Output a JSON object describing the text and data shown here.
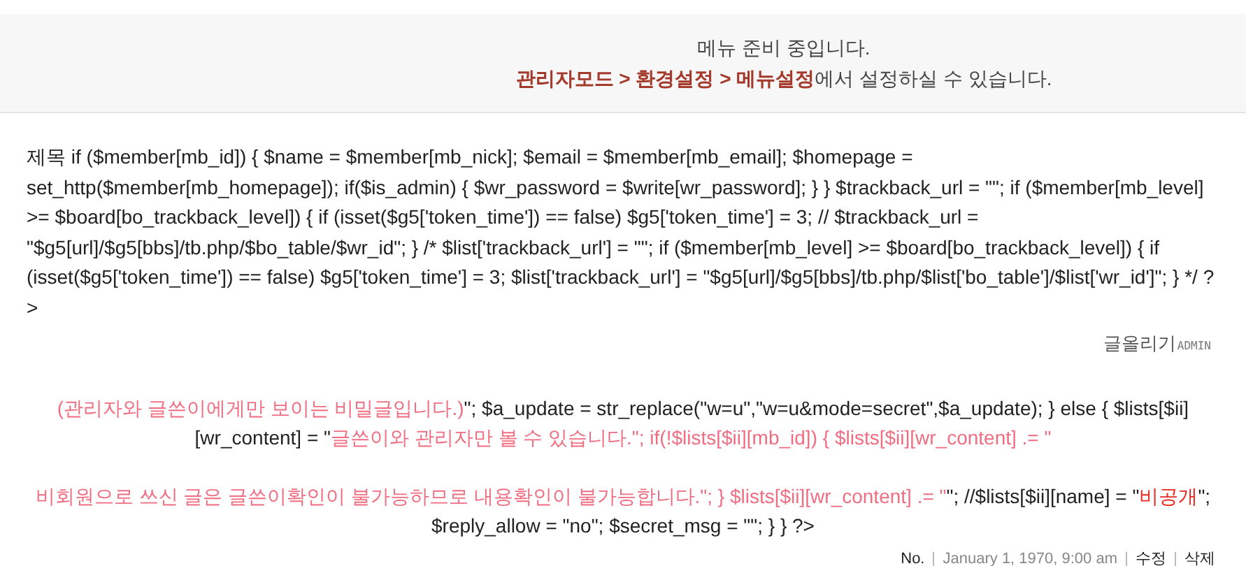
{
  "notice": {
    "message": "메뉴 준비 중입니다.",
    "path": "관리자모드 > 환경설정 > 메뉴설정",
    "suffix": "에서 설정하실 수 있습니다."
  },
  "post": {
    "body": "제목 if ($member[mb_id]) { $name = $member[mb_nick]; $email = $member[mb_email]; $homepage = set_http($member[mb_homepage]); if($is_admin) { $wr_password = $write[wr_password]; } } $trackback_url = \"\"; if ($member[mb_level] >= $board[bo_trackback_level]) { if (isset($g5['token_time']) == false) $g5['token_time'] = 3; // $trackback_url = \"$g5[url]/$g5[bbs]/tb.php/$bo_table/$wr_id\"; } /* $list['trackback_url'] = \"\"; if ($member[mb_level] >= $board[bo_trackback_level]) { if (isset($g5['token_time']) == false) $g5['token_time'] = 3; $list['trackback_url'] = \"$g5[url]/$g5[bbs]/tb.php/$list['bo_table']/$list['wr_id']\"; } */ ?>",
    "author": {
      "name": "글올리기",
      "badge": "ADMIN"
    }
  },
  "comment": {
    "segments": [
      {
        "kind": "pink",
        "text": "(관리자와 글쓴이에게만 보이는 비밀글입니다.)"
      },
      {
        "kind": "plain",
        "text": "\"; $a_update = str_replace(\"w=u\",\"w=u&mode=secret\",$a_update); } else { $lists[$ii][wr_content] = \""
      },
      {
        "kind": "pink",
        "text": "글쓴이와 관리자만 볼 수 있습니다.\"; if(!$lists[$ii][mb_id]) { $lists[$ii][wr_content] .= \""
      },
      {
        "kind": "break"
      },
      {
        "kind": "pink",
        "text": "비회원으로 쓰신 글은 글쓴이확인이 불가능하므로 내용확인이 불가능합니다.\"; } $lists[$ii][wr_content] .= \""
      },
      {
        "kind": "plain",
        "text": "\"; //$lists[$ii][name] = \""
      },
      {
        "kind": "red",
        "text": "비공개"
      },
      {
        "kind": "plain",
        "text": "\"; $reply_allow = \"no\"; $secret_msg = \"\"; } } ?>"
      }
    ],
    "meta": {
      "number": "No.",
      "date": "January 1, 1970, 9:00 am",
      "edit": "수정",
      "delete": "삭제"
    }
  }
}
